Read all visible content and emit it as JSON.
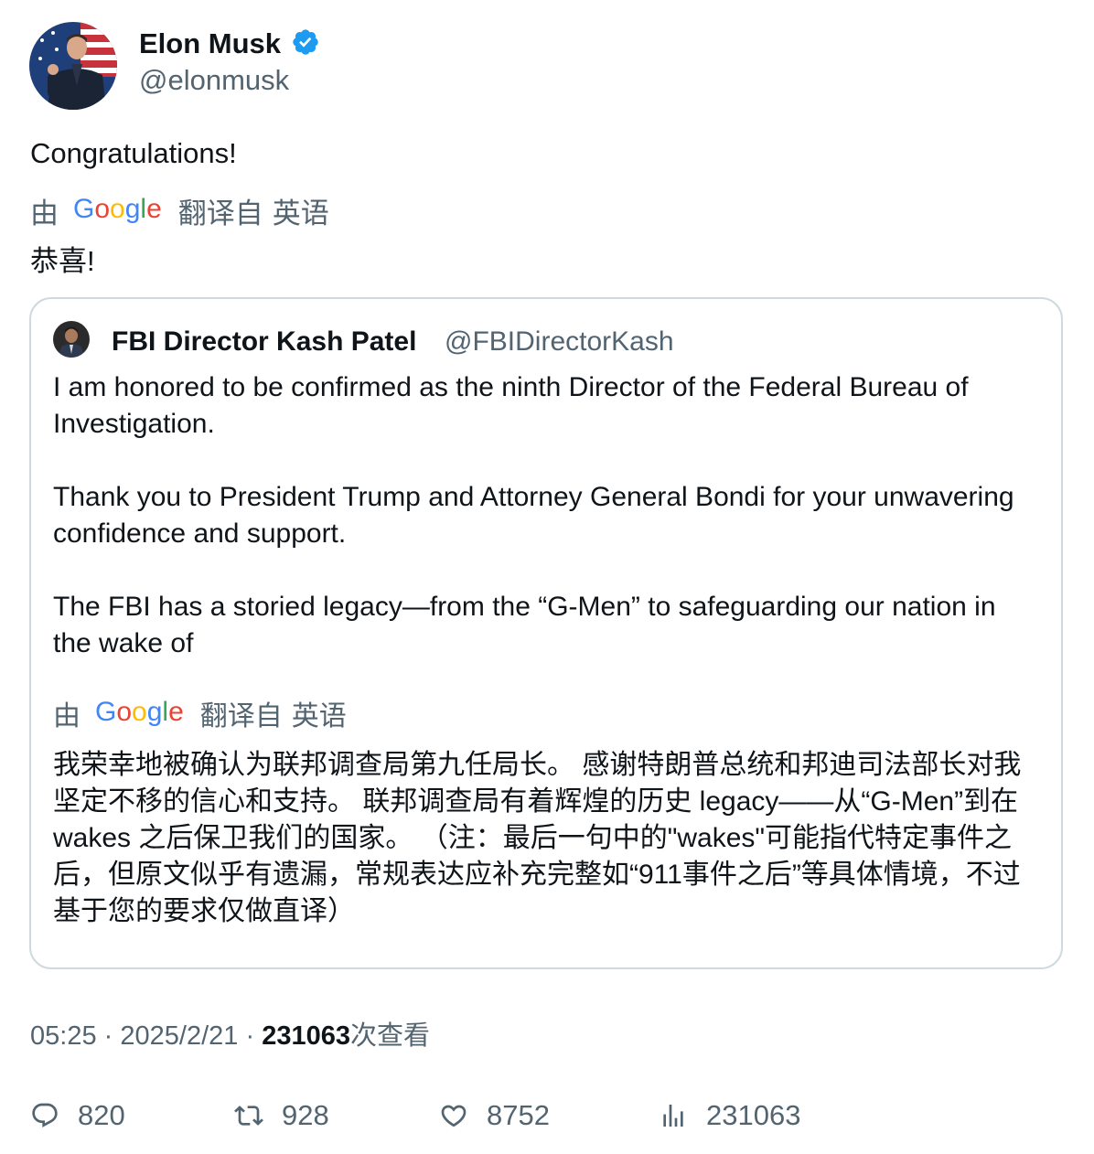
{
  "author": {
    "name": "Elon Musk",
    "handle": "@elonmusk",
    "verified": true,
    "avatar_icon": "avatar-photo"
  },
  "tweet": {
    "text": "Congratulations!",
    "translation": {
      "prefix": "由",
      "provider": "Google",
      "suffix": "翻译自",
      "language": "英语",
      "text": "恭喜!"
    }
  },
  "quote": {
    "author_name": "FBI Director Kash Patel",
    "author_handle": "@FBIDirectorKash",
    "paragraphs": [
      "I am honored to be confirmed as the ninth Director of the Federal Bureau of Investigation.",
      "Thank you to President Trump and Attorney General Bondi for your unwavering confidence and support.",
      "The FBI has a storied legacy—from the “G-Men” to safeguarding our nation in the wake of"
    ],
    "translation": {
      "prefix": "由",
      "provider": "Google",
      "suffix": "翻译自",
      "language": "英语",
      "text": "我荣幸地被确认为联邦调查局第九任局长。 感谢特朗普总统和邦迪司法部长对我坚定不移的信心和支持。 联邦调查局有着辉煌的历史 legacy——从“G-Men”到在 wakes 之后保卫我们的国家。 （注：最后一句中的\"wakes\"可能指代特定事件之后，但原文似乎有遗漏，常规表达应补充完整如“911事件之后”等具体情境，不过基于您的要求仅做直译）"
    }
  },
  "meta": {
    "time": "05:25",
    "date": "2025/2/21",
    "views": "231063",
    "views_label": "次查看",
    "separator": "·"
  },
  "actions": {
    "replies": "820",
    "retweets": "928",
    "likes": "8752",
    "views": "231063"
  },
  "colors": {
    "text": "#0f1419",
    "secondary": "#536471",
    "border": "#cfd9de",
    "verified": "#1d9bf0"
  }
}
